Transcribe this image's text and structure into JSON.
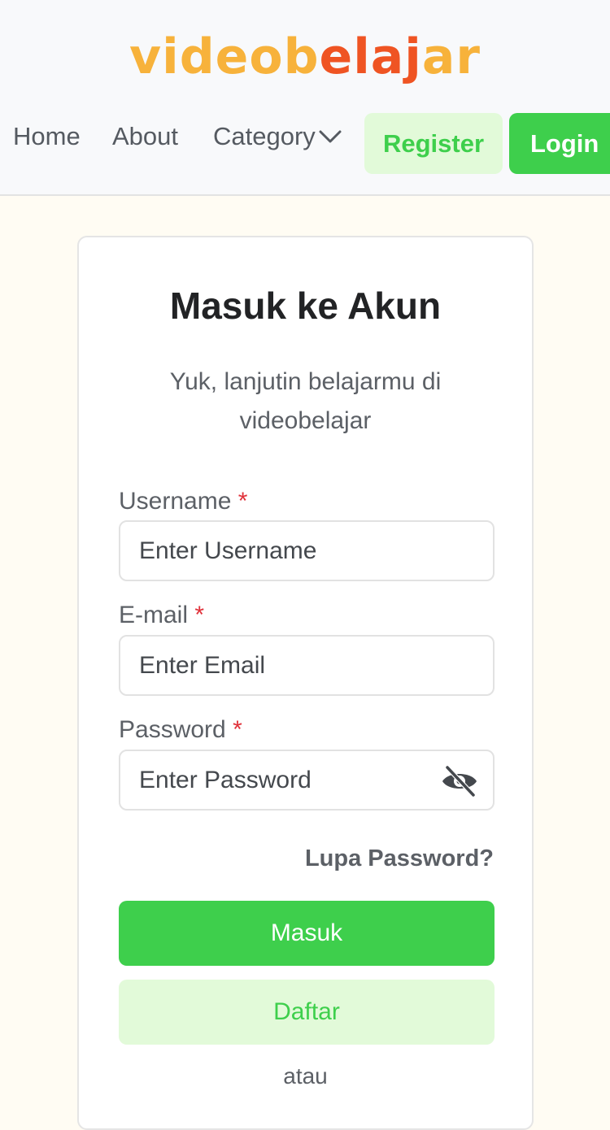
{
  "brand": {
    "part1": "videob",
    "part2": "elaj",
    "part3": "ar"
  },
  "nav": {
    "home": "Home",
    "about": "About",
    "category": "Category",
    "register": "Register",
    "login": "Login"
  },
  "card": {
    "title": "Masuk ke Akun",
    "subtitle": "Yuk, lanjutin belajarmu di videobelajar",
    "username": {
      "label": "Username",
      "required": "*",
      "placeholder": "Enter Username"
    },
    "email": {
      "label": "E-mail",
      "required": "*",
      "placeholder": "Enter Email"
    },
    "password": {
      "label": "Password",
      "required": "*",
      "placeholder": "Enter Password"
    },
    "forgot": "Lupa Password?",
    "submit": "Masuk",
    "register": "Daftar",
    "divider": "atau"
  },
  "colors": {
    "primary": "#3ecf4c",
    "primary_light": "#e2fad9",
    "logo_orange": "#f7b23b",
    "logo_red": "#ef5423",
    "required": "#e0313a"
  },
  "icons": {
    "category_toggle": "chevron-down-icon",
    "password_visibility": "eye-off-icon"
  }
}
